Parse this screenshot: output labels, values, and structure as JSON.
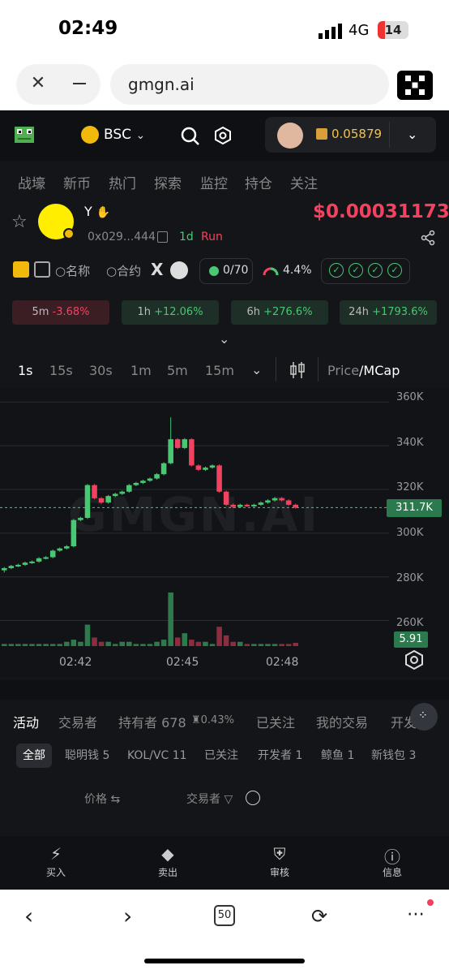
{
  "status": {
    "time": "02:49",
    "network": "4G",
    "battery": "14"
  },
  "browser": {
    "url": "gmgn.ai",
    "tabs_count": "50"
  },
  "header": {
    "chain": "BSC",
    "balance": "0.05879"
  },
  "nav": [
    "战壕",
    "新币",
    "热门",
    "探索",
    "监控",
    "持仓",
    "关注"
  ],
  "token": {
    "name": "Y",
    "address": "0x029...444",
    "period": "1d",
    "status": "Run",
    "price": "$0.00031173"
  },
  "tools": {
    "name_label": "名称",
    "contract_label": "合约",
    "holders": "0/70",
    "top_pct": "4.4%"
  },
  "changes": [
    {
      "period": "5m",
      "value": "-3.68%",
      "dir": "neg"
    },
    {
      "period": "1h",
      "value": "+12.06%",
      "dir": "pos"
    },
    {
      "period": "6h",
      "value": "+276.6%",
      "dir": "pos"
    },
    {
      "period": "24h",
      "value": "+1793.6%",
      "dir": "pos"
    }
  ],
  "timeframes": [
    "1s",
    "15s",
    "30s",
    "1m",
    "5m",
    "15m"
  ],
  "active_timeframe": "1s",
  "price_mode": {
    "a": "Price",
    "b": "/MCap"
  },
  "chart_data": {
    "type": "candlestick",
    "y_axis_labels": [
      "360K",
      "340K",
      "320K",
      "300K",
      "280K",
      "260K"
    ],
    "ylim": [
      255,
      362
    ],
    "x_axis_labels": [
      "02:42",
      "02:45",
      "02:48"
    ],
    "current_price": "311.7K",
    "current_volume": "5.91",
    "watermark": "GMGN.AI",
    "candles": [
      {
        "o": 283.0,
        "c": 284.0,
        "h": 284.5,
        "l": 282.0
      },
      {
        "o": 284.0,
        "c": 285.0,
        "h": 285.5,
        "l": 283.5
      },
      {
        "o": 285.0,
        "c": 285.5,
        "h": 286,
        "l": 284.5
      },
      {
        "o": 285.5,
        "c": 286.5,
        "h": 287,
        "l": 285
      },
      {
        "o": 286.5,
        "c": 287.0,
        "h": 287.5,
        "l": 286
      },
      {
        "o": 287.0,
        "c": 288.5,
        "h": 289,
        "l": 286.5
      },
      {
        "o": 288.5,
        "c": 289.0,
        "h": 289.5,
        "l": 288
      },
      {
        "o": 289.0,
        "c": 292.0,
        "h": 292.5,
        "l": 288.5
      },
      {
        "o": 292.0,
        "c": 293.0,
        "h": 293.5,
        "l": 291.5
      },
      {
        "o": 293.0,
        "c": 294.0,
        "h": 294.5,
        "l": 292.5
      },
      {
        "o": 294.0,
        "c": 306.0,
        "h": 306.5,
        "l": 293.5
      },
      {
        "o": 306.0,
        "c": 307.0,
        "h": 307.5,
        "l": 305.5
      },
      {
        "o": 307.0,
        "c": 322.0,
        "h": 322.5,
        "l": 306.5
      },
      {
        "o": 322.0,
        "c": 316.0,
        "h": 322.5,
        "l": 315.5
      },
      {
        "o": 316.0,
        "c": 314.0,
        "h": 316.5,
        "l": 313.5
      },
      {
        "o": 314.0,
        "c": 317.0,
        "h": 317.5,
        "l": 313.5
      },
      {
        "o": 317.0,
        "c": 318.0,
        "h": 318.5,
        "l": 316.5
      },
      {
        "o": 318.0,
        "c": 319.0,
        "h": 319.5,
        "l": 317.5
      },
      {
        "o": 319.0,
        "c": 322.0,
        "h": 322.5,
        "l": 318.5
      },
      {
        "o": 322.0,
        "c": 323.0,
        "h": 323.5,
        "l": 321.5
      },
      {
        "o": 323.0,
        "c": 324.0,
        "h": 324.5,
        "l": 322.5
      },
      {
        "o": 324.0,
        "c": 325.0,
        "h": 325.5,
        "l": 323.5
      },
      {
        "o": 325.0,
        "c": 327.0,
        "h": 327.5,
        "l": 324.5
      },
      {
        "o": 327.0,
        "c": 332.0,
        "h": 332.5,
        "l": 326.5
      },
      {
        "o": 332.0,
        "c": 343.0,
        "h": 353,
        "l": 331.5
      },
      {
        "o": 343.0,
        "c": 339.0,
        "h": 343.5,
        "l": 338.5
      },
      {
        "o": 339.0,
        "c": 343.0,
        "h": 343.5,
        "l": 338.5
      },
      {
        "o": 343.0,
        "c": 331.0,
        "h": 343.5,
        "l": 330.5
      },
      {
        "o": 331.0,
        "c": 329.0,
        "h": 331.5,
        "l": 328.5
      },
      {
        "o": 329.0,
        "c": 330.0,
        "h": 330.5,
        "l": 328.5
      },
      {
        "o": 330.0,
        "c": 331.0,
        "h": 331.5,
        "l": 329.5
      },
      {
        "o": 331.0,
        "c": 319.0,
        "h": 331.5,
        "l": 318.5
      },
      {
        "o": 319.0,
        "c": 313.0,
        "h": 319.5,
        "l": 312.5
      },
      {
        "o": 313.0,
        "c": 312.0,
        "h": 313.5,
        "l": 311.5
      },
      {
        "o": 312.0,
        "c": 313.0,
        "h": 313.5,
        "l": 311.5
      },
      {
        "o": 313.0,
        "c": 312.5,
        "h": 313.5,
        "l": 312
      },
      {
        "o": 312.5,
        "c": 313.0,
        "h": 313.5,
        "l": 312
      },
      {
        "o": 313.0,
        "c": 314.0,
        "h": 314.5,
        "l": 312.5
      },
      {
        "o": 314.0,
        "c": 315.0,
        "h": 315.5,
        "l": 313.5
      },
      {
        "o": 315.0,
        "c": 316.0,
        "h": 316.5,
        "l": 314.5
      },
      {
        "o": 316.0,
        "c": 315.0,
        "h": 316.5,
        "l": 314.5
      },
      {
        "o": 315.0,
        "c": 313.0,
        "h": 315.5,
        "l": 312.5
      },
      {
        "o": 313.0,
        "c": 311.7,
        "h": 313.5,
        "l": 311.2
      }
    ],
    "volumes": [
      1,
      1,
      1,
      1,
      1,
      1,
      1,
      1,
      1,
      2,
      3,
      2,
      10,
      4,
      2,
      2,
      1,
      2,
      2,
      1,
      1,
      1,
      2,
      3,
      25,
      4,
      6,
      3,
      2,
      2,
      1,
      9,
      5,
      2,
      2,
      1,
      1,
      1,
      1,
      1,
      1,
      1,
      1.5
    ]
  },
  "activity_tabs": [
    "活动",
    "交易者",
    "持有者 678",
    "0.43%",
    "已关注",
    "我的交易",
    "开发"
  ],
  "sub_tabs": [
    "全部",
    "聪明钱 5",
    "KOL/VC 11",
    "已关注",
    "开发者 1",
    "鲸鱼 1",
    "新钱包 3"
  ],
  "columns": {
    "price": "价格",
    "trader": "交易者"
  },
  "bottom_nav": [
    {
      "label": "买入",
      "icon": "lightning-icon"
    },
    {
      "label": "卖出",
      "icon": "tag-icon"
    },
    {
      "label": "审核",
      "icon": "shield-icon"
    },
    {
      "label": "信息",
      "icon": "info-icon"
    }
  ],
  "colors": {
    "up": "#48c873",
    "down": "#f2425f",
    "bg": "#141518"
  }
}
